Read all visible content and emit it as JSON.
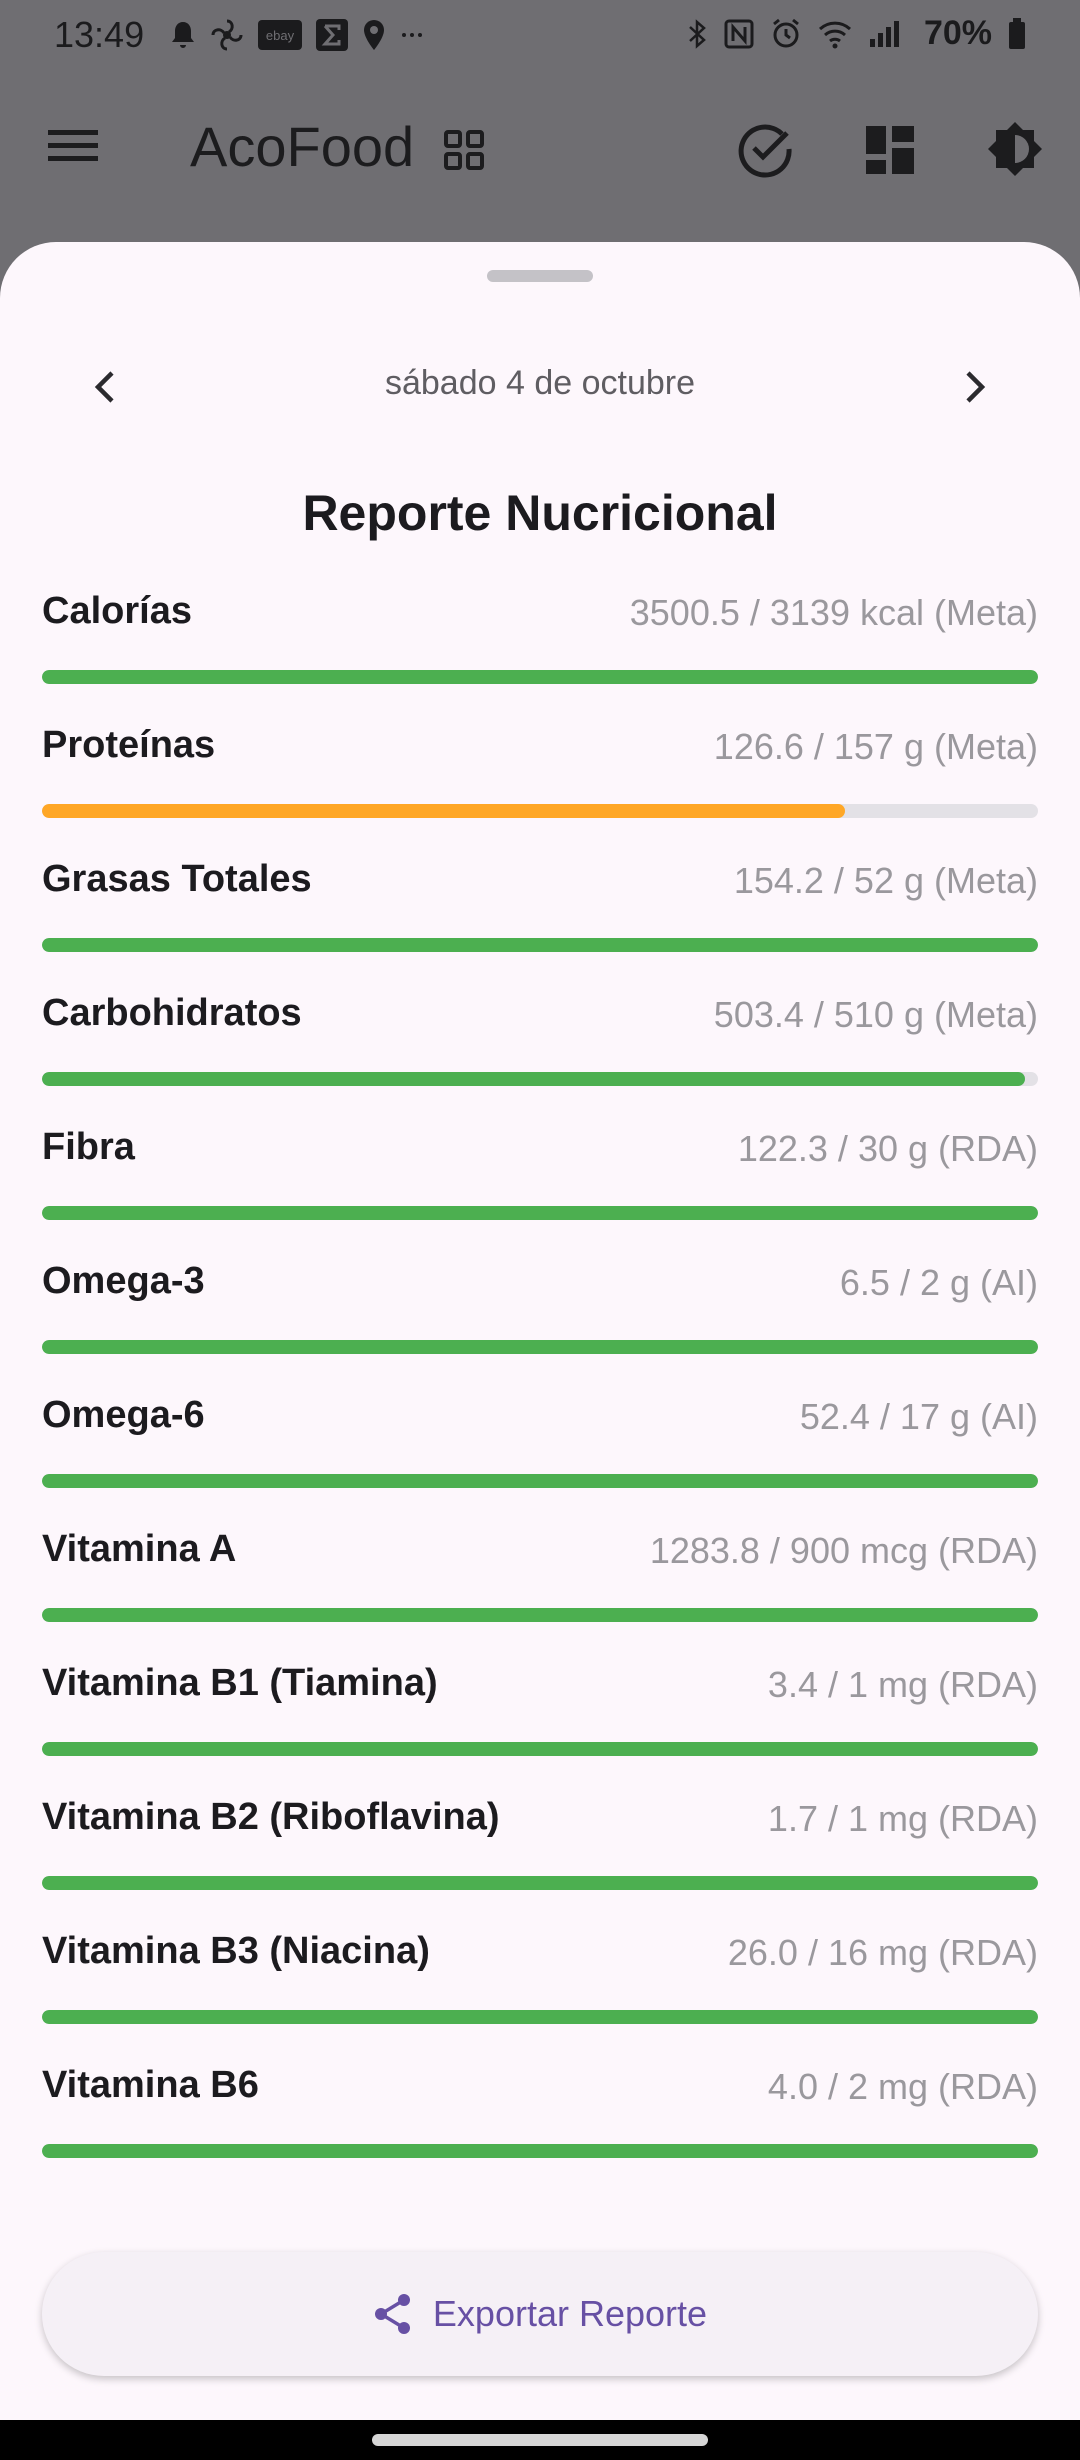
{
  "status": {
    "time": "13:49",
    "battery": "70%"
  },
  "app": {
    "title": "AcoFood"
  },
  "sheet": {
    "date": "sábado 4 de octubre",
    "title": "Reporte Nucricional"
  },
  "nutrients": [
    {
      "label": "Calorías",
      "value": "3500.5 / 3139 kcal (Meta)",
      "progress": 1.0,
      "color": "#4caf50"
    },
    {
      "label": "Proteínas",
      "value": "126.6 / 157 g (Meta)",
      "progress": 0.806,
      "color": "#ffa726"
    },
    {
      "label": "Grasas Totales",
      "value": "154.2 / 52 g (Meta)",
      "progress": 1.0,
      "color": "#4caf50"
    },
    {
      "label": "Carbohidratos",
      "value": "503.4 / 510 g (Meta)",
      "progress": 0.987,
      "color": "#4caf50"
    },
    {
      "label": "Fibra",
      "value": "122.3 / 30 g (RDA)",
      "progress": 1.0,
      "color": "#4caf50"
    },
    {
      "label": "Omega-3",
      "value": "6.5 / 2 g (AI)",
      "progress": 1.0,
      "color": "#4caf50"
    },
    {
      "label": "Omega-6",
      "value": "52.4 / 17 g (AI)",
      "progress": 1.0,
      "color": "#4caf50"
    },
    {
      "label": "Vitamina A",
      "value": "1283.8 / 900 mcg (RDA)",
      "progress": 1.0,
      "color": "#4caf50"
    },
    {
      "label": "Vitamina B1 (Tiamina)",
      "value": "3.4 / 1 mg (RDA)",
      "progress": 1.0,
      "color": "#4caf50"
    },
    {
      "label": "Vitamina B2 (Riboflavina)",
      "value": "1.7 / 1 mg (RDA)",
      "progress": 1.0,
      "color": "#4caf50"
    },
    {
      "label": "Vitamina B3 (Niacina)",
      "value": "26.0 / 16 mg (RDA)",
      "progress": 1.0,
      "color": "#4caf50"
    },
    {
      "label": "Vitamina B6",
      "value": "4.0 / 2 mg (RDA)",
      "progress": 1.0,
      "color": "#4caf50"
    }
  ],
  "export": {
    "label": "Exportar Reporte",
    "icon": "share-icon"
  },
  "colors": {
    "accent": "#6750a4",
    "good": "#4caf50",
    "warning": "#ffa726"
  }
}
